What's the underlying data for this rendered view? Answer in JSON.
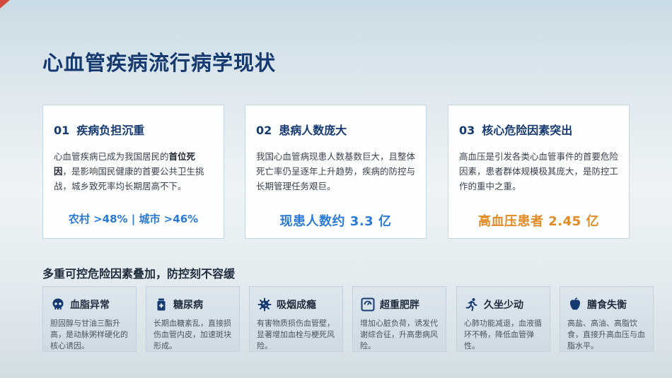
{
  "title": "心血管疾病流行病学现状",
  "cards": [
    {
      "num": "01",
      "title": "疾病负担沉重",
      "body_pre": "心血管疾病已成为我国居民的",
      "body_bold": "首位死因",
      "body_post": "，是影响国民健康的首要公共卫生挑战，城乡致死率均长期居高不下。",
      "stat": "农村 >48% | 城市 >46%"
    },
    {
      "num": "02",
      "title": "患病人数庞大",
      "body": "我国心血管病现患人数基数巨大，且整体死亡率仍呈逐年上升趋势，疾病的防控与长期管理任务艰巨。",
      "stat": "现患人数约 3.3 亿"
    },
    {
      "num": "03",
      "title": "核心危险因素突出",
      "body": "高血压是引发各类心血管事件的首要危险因素，患者群体规模极其庞大，是防控工作的重中之重。",
      "stat": "高血压患者 2.45 亿"
    }
  ],
  "section_title": "多重可控危险因素叠加，防控刻不容缓",
  "risks": [
    {
      "name": "血脂异常",
      "icon": "skull-icon",
      "desc": "胆固醇与甘油三酯升高，是动脉粥样硬化的核心诱因。"
    },
    {
      "name": "糖尿病",
      "icon": "medicine-bottle-icon",
      "desc": "长期血糖紊乱，直接损伤血管内皮，加速斑块形成。"
    },
    {
      "name": "吸烟成瘾",
      "icon": "virus-icon",
      "desc": "有害物质损伤血管壁，显著增加血栓与梗死风险。"
    },
    {
      "name": "超重肥胖",
      "icon": "scale-icon",
      "desc": "增加心脏负荷，诱发代谢综合征，升高患病风险。"
    },
    {
      "name": "久坐少动",
      "icon": "running-person-icon",
      "desc": "心肺功能减退，血液循环不畅，降低血管弹性。"
    },
    {
      "name": "膳食失衡",
      "icon": "food-icon",
      "desc": "高盐、高油、高脂饮食，直接升高血压与血脂水平。"
    }
  ],
  "colors": {
    "title": "#163a70",
    "stat_blue": "#2d7ad4",
    "stat_orange": "#e28a26",
    "icon": "#163a70"
  }
}
